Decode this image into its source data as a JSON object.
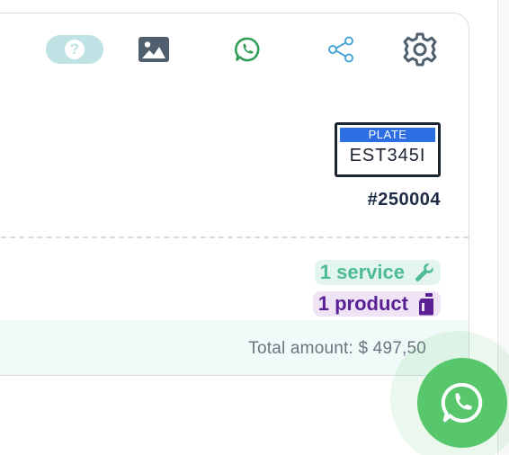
{
  "toolbar": {
    "help_glyph": "?",
    "icons": [
      "help-icon",
      "image-icon",
      "whatsapp-icon",
      "share-icon",
      "gear-icon"
    ]
  },
  "vehicle": {
    "plate_header": "PLATE",
    "plate_number": "EST345I"
  },
  "order": {
    "number": "#250004"
  },
  "summary": {
    "service_label": "1 service",
    "product_label": "1 product",
    "total_label": "Total amount: $ 497,50"
  },
  "colors": {
    "help_pill": "#bfe3e4",
    "whatsapp_green": "#2f9e55",
    "share_blue": "#4aa6d6",
    "service_green": "#4dbb93",
    "product_purple": "#5a1f93",
    "plate_blue": "#2d6fe3",
    "fab_green": "#58c76c"
  },
  "fab": {
    "icon": "whatsapp-icon"
  }
}
